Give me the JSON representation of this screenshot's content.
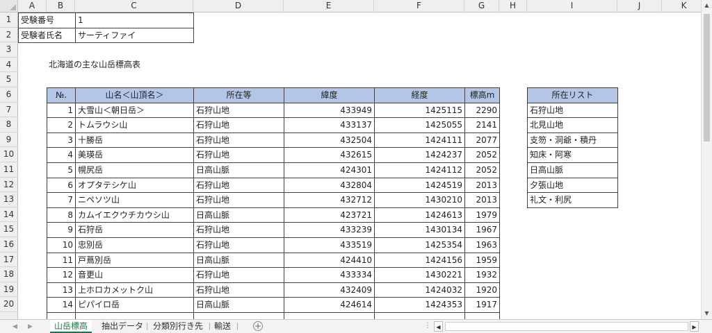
{
  "columns": [
    "A",
    "B",
    "C",
    "D",
    "E",
    "F",
    "G",
    "H",
    "I",
    "J",
    "K"
  ],
  "rows": [
    "1",
    "2",
    "3",
    "4",
    "5",
    "6",
    "7",
    "8",
    "9",
    "10",
    "11",
    "12",
    "13",
    "14",
    "15",
    "16",
    "17",
    "18",
    "19",
    "20"
  ],
  "exam": {
    "number_label": "受験番号",
    "number_value": "1",
    "name_label": "受験者氏名",
    "name_value": "サーティファイ"
  },
  "sheet_title": "北海道の主な山岳標高表",
  "table": {
    "headers": [
      "№.",
      "山名＜山頂名＞",
      "所在等",
      "緯度",
      "経度",
      "標高m"
    ],
    "rows": [
      [
        "1",
        "大雪山＜朝日岳＞",
        "石狩山地",
        "433949",
        "1425115",
        "2290"
      ],
      [
        "2",
        "トムラウシ山",
        "石狩山地",
        "433137",
        "1425055",
        "2141"
      ],
      [
        "3",
        "十勝岳",
        "石狩山地",
        "432504",
        "1424111",
        "2077"
      ],
      [
        "4",
        "美瑛岳",
        "石狩山地",
        "432615",
        "1424237",
        "2052"
      ],
      [
        "5",
        "幌尻岳",
        "日高山脈",
        "424301",
        "1424112",
        "2052"
      ],
      [
        "6",
        "オプタテシケ山",
        "石狩山地",
        "432804",
        "1424519",
        "2013"
      ],
      [
        "7",
        "ニペソツ山",
        "石狩山地",
        "432712",
        "1430210",
        "2013"
      ],
      [
        "8",
        "カムイエクウチカウシ山",
        "日高山脈",
        "423721",
        "1424613",
        "1979"
      ],
      [
        "9",
        "石狩岳",
        "石狩山地",
        "433239",
        "1430134",
        "1967"
      ],
      [
        "10",
        "忠別岳",
        "石狩山地",
        "433519",
        "1425354",
        "1963"
      ],
      [
        "11",
        "戸蔦別岳",
        "日高山脈",
        "424410",
        "1424156",
        "1959"
      ],
      [
        "12",
        "音更山",
        "石狩山地",
        "433334",
        "1430221",
        "1932"
      ],
      [
        "13",
        "上ホロカメットク山",
        "石狩山地",
        "432409",
        "1424032",
        "1920"
      ],
      [
        "14",
        "ピパイロ岳",
        "日高山脈",
        "424614",
        "1424353",
        "1917"
      ]
    ]
  },
  "location_list": {
    "header": "所在リスト",
    "items": [
      "石狩山地",
      "北見山地",
      "支笏・洞爺・積丹",
      "知床・阿寒",
      "日高山脈",
      "夕張山地",
      "礼文・利尻"
    ]
  },
  "sheet_tabs": [
    "山岳標高",
    "抽出データ",
    "分類別行き先",
    "輸送"
  ],
  "active_tab": "山岳標高",
  "add_sheet_symbol": "+",
  "accent_color": "#217346",
  "table_header_color": "#b4c6e7"
}
